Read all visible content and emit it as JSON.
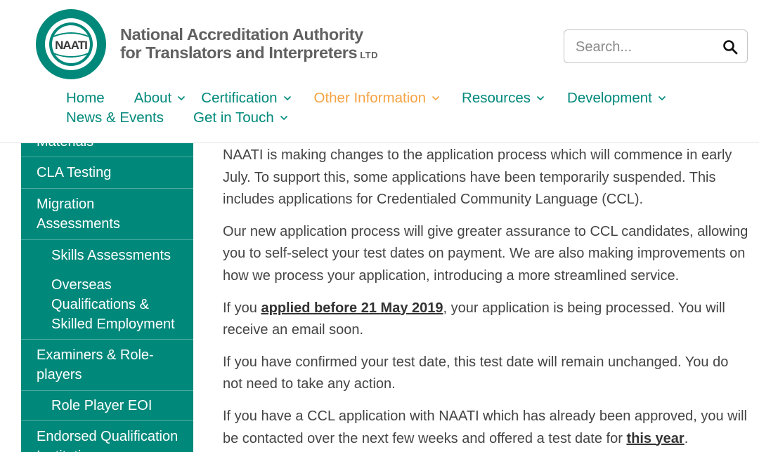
{
  "header": {
    "org_line1": "National Accreditation Authority",
    "org_line2": "for Translators and Interpreters",
    "org_suffix": "LTD",
    "logo_text": "NAATI",
    "search_placeholder": "Search..."
  },
  "nav": {
    "row1": [
      {
        "label": "Home",
        "has_dropdown": false,
        "active": false
      },
      {
        "label": "About",
        "has_dropdown": true,
        "active": false
      },
      {
        "label": "Certification",
        "has_dropdown": true,
        "active": false
      },
      {
        "label": "Other Information",
        "has_dropdown": true,
        "active": true
      },
      {
        "label": "Resources",
        "has_dropdown": true,
        "active": false
      },
      {
        "label": "Development",
        "has_dropdown": true,
        "active": false
      }
    ],
    "row2": [
      {
        "label": "News & Events",
        "has_dropdown": false,
        "active": false
      },
      {
        "label": "Get in Touch",
        "has_dropdown": true,
        "active": false
      }
    ]
  },
  "sidebar": {
    "items": [
      {
        "label": "Materials",
        "level": 1
      },
      {
        "label": "CLA Testing",
        "level": 1
      },
      {
        "label": "Migration Assessments",
        "level": 1
      },
      {
        "label": "Skills Assessments",
        "level": 2
      },
      {
        "label": "Overseas Qualifications & Skilled Employment",
        "level": 2
      },
      {
        "label": "Examiners & Role-players",
        "level": 1
      },
      {
        "label": "Role Player EOI",
        "level": 2
      },
      {
        "label": "Endorsed Qualification Institutions",
        "level": 1
      }
    ]
  },
  "content": {
    "p1": "NAATI is making changes to the application process which will commence in early July. To support this, some applications have been temporarily suspended. This includes applications for Credentialed Community Language (CCL).",
    "p2": "Our new application process will give greater assurance to CCL candidates, allowing you to self-select your test dates on payment. We are also making improvements on how we process your application, introducing a more streamlined service.",
    "p3_pre": "If you ",
    "p3_link": "applied before 21 May 2019",
    "p3_post": ", your application is being processed. You will receive an email soon.",
    "p4": "If you have confirmed your test date, this test date will remain unchanged. You do not need to take any action.",
    "p5_pre": "If you have a CCL application with NAATI which has already been approved, you will be contacted over the next few weeks and offered a test date for ",
    "p5_link": "this year",
    "p5_post": "."
  },
  "colors": {
    "brand_teal": "#00897b",
    "nav_active": "#f5a343",
    "org_text": "#616161"
  }
}
